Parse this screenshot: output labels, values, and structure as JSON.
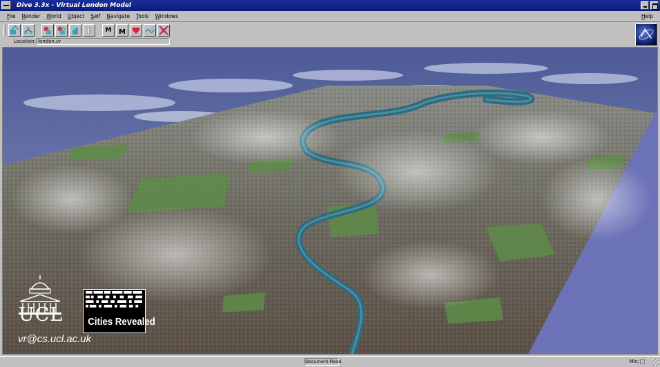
{
  "window": {
    "title": "Dive 3.3x - Virtual London Model"
  },
  "menu": {
    "items": [
      "File",
      "Render",
      "World",
      "Object",
      "Self",
      "Navigate",
      "Tools",
      "Windows"
    ],
    "help": "Help"
  },
  "toolbar": {
    "buttons": [
      {
        "name": "load-world",
        "icon": "world-load-icon"
      },
      {
        "name": "tree-view",
        "icon": "tree-icon"
      },
      {
        "name": "object-red-1",
        "icon": "red-object-icon"
      },
      {
        "name": "object-red-2",
        "icon": "red-object-icon"
      },
      {
        "name": "object-cyan",
        "icon": "cyan-object-icon"
      },
      {
        "name": "object-grey",
        "icon": "grey-object-icon"
      },
      {
        "name": "m-small",
        "label": "M"
      },
      {
        "name": "m-large",
        "label": "M"
      },
      {
        "name": "heart",
        "icon": "heart-icon"
      },
      {
        "name": "wave",
        "icon": "wave-icon"
      },
      {
        "name": "cross-out",
        "icon": "cross-out-icon"
      }
    ],
    "logo_icon": "dive-globe-logo-icon"
  },
  "location": {
    "label": "Location:",
    "value": "london.vr"
  },
  "viewport": {
    "overlay": {
      "ucl_text": "UCL",
      "cities_revealed_text": "Cities Revealed",
      "email": "vr@cs.ucl.ac.uk"
    },
    "colors": {
      "sky": "#5e6ca8",
      "river": "#2e6a80",
      "city": "#6a6a60",
      "park": "#5a8a44"
    }
  },
  "status": {
    "message": "Document Read.",
    "mic_label": "Mic:"
  }
}
